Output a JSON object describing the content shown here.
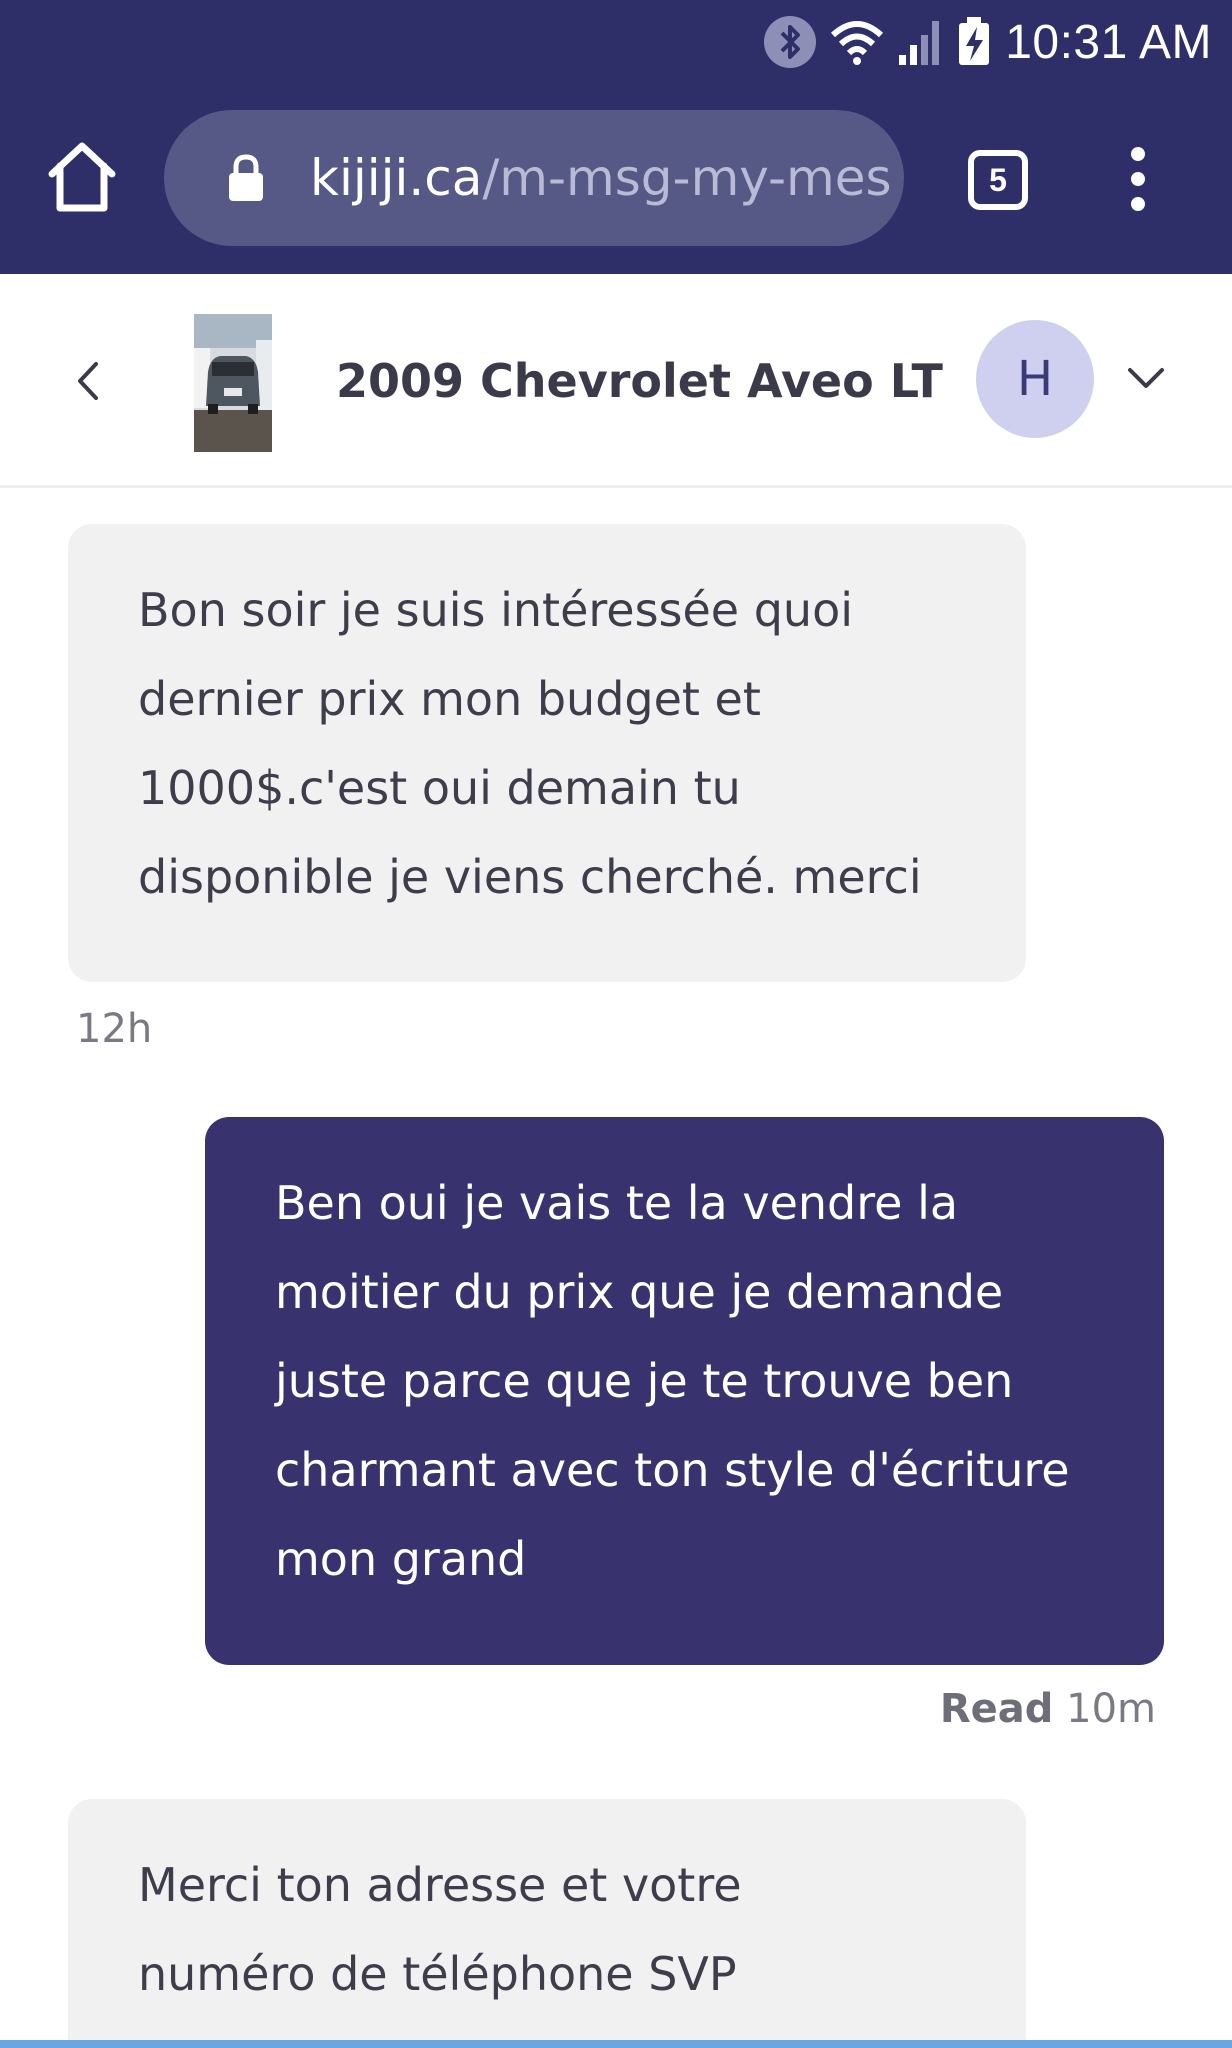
{
  "status_bar": {
    "time": "10:31 AM",
    "icons": [
      "bluetooth-icon",
      "wifi-icon",
      "signal-icon",
      "battery-charging-icon"
    ]
  },
  "browser": {
    "url_domain": "kijiji.ca",
    "url_path": "/m-msg-my-mes",
    "tab_count": "5",
    "icons": [
      "home-icon",
      "lock-icon",
      "tabs-icon",
      "overflow-menu-icon"
    ]
  },
  "conversation": {
    "title": "2009 Chevrolet Aveo LT",
    "avatar_initial": "H",
    "icons": [
      "back-chevron-icon",
      "listing-photo",
      "chevron-down-icon"
    ]
  },
  "messages": [
    {
      "direction": "incoming",
      "text": "Bon soir je suis intéressée quoi\ndernier prix mon budget et\n1000$.c'est oui demain tu\ndisponible je viens cherché. merci",
      "time": "12h"
    },
    {
      "direction": "outgoing",
      "text": "Ben oui je vais te la vendre la\nmoitier du prix que je demande\njuste parce que je te trouve ben\ncharmant avec ton style d'écriture\nmon grand",
      "status": "Read",
      "time": "10m"
    },
    {
      "direction": "incoming",
      "text": "Merci ton adresse et votre\nnuméro de téléphone SVP"
    }
  ],
  "colors": {
    "chrome": "#2e2e68",
    "outgoing_bubble": "#38326f",
    "incoming_bubble": "#f1f1f2",
    "avatar": "#cfd0f0"
  }
}
